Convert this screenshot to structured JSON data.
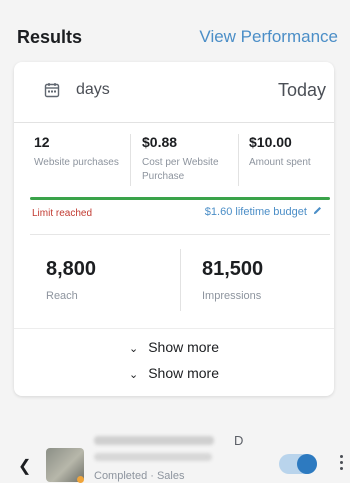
{
  "header": {
    "title": "Results",
    "view_performance": "View Performance"
  },
  "date_range": {
    "icon": "calendar-icon",
    "label": "days",
    "end": "Today"
  },
  "metrics": [
    {
      "value": "12",
      "label": "Website purchases"
    },
    {
      "value": "$0.88",
      "label": "Cost per Website Purchase"
    },
    {
      "value": "$10.00",
      "label": "Amount spent"
    }
  ],
  "budget": {
    "progress_fraction": 1.0,
    "limit_text": "Limit reached",
    "budget_text": "$1.60 lifetime budget",
    "edit_icon": "pencil-icon"
  },
  "summary": [
    {
      "value": "8,800",
      "label": "Reach"
    },
    {
      "value": "81,500",
      "label": "Impressions"
    }
  ],
  "show_more": [
    "Show more",
    "Show more"
  ],
  "ad_row": {
    "back_icon": "chevron-left-icon",
    "name_suffix": "D",
    "status": "Completed · Sales",
    "toggle_on": true,
    "more_icon": "more-vertical-icon"
  },
  "colors": {
    "accent": "#4b8ec7",
    "success": "#3aa34a",
    "error": "#c23b32",
    "toggle_on": "#2d7ac0"
  }
}
